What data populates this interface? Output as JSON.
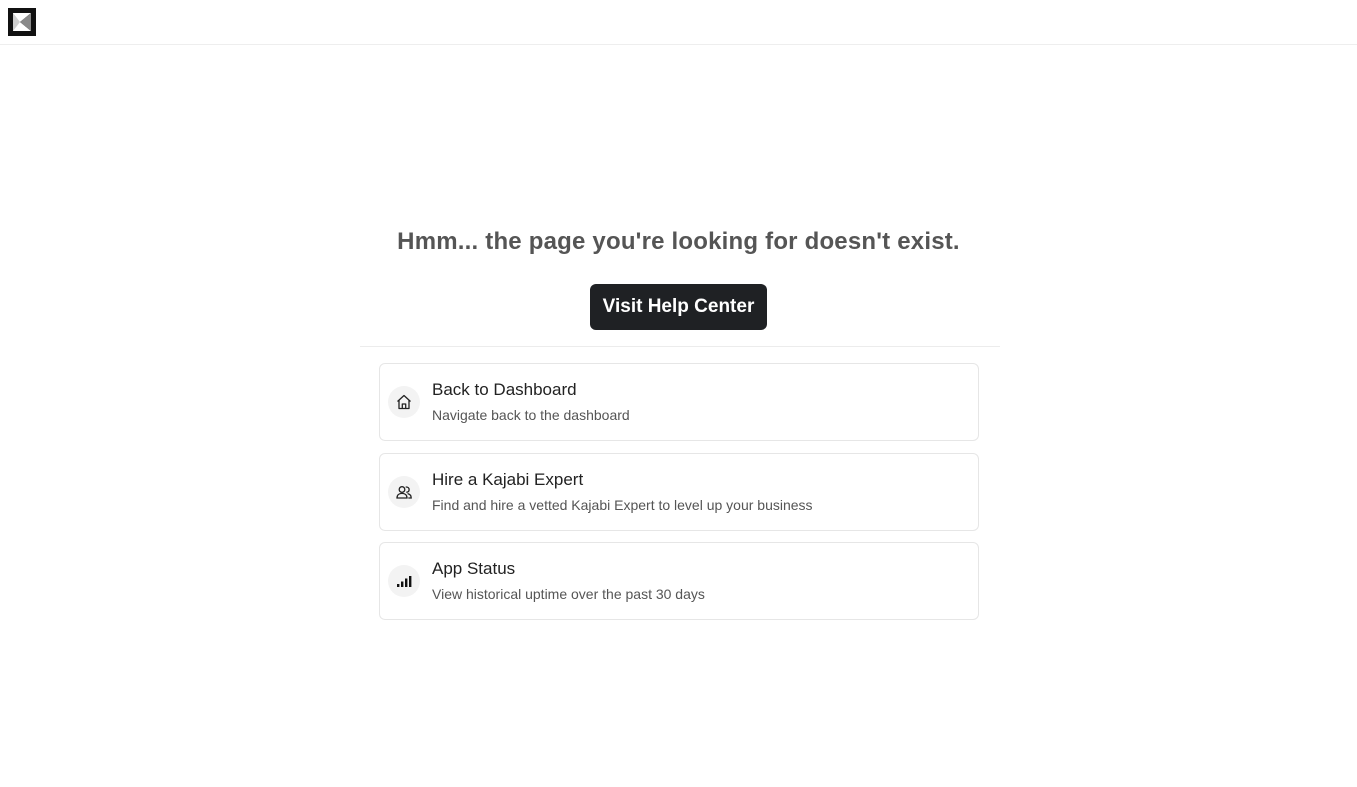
{
  "header": {
    "logo_icon": "kajabi-logo-icon"
  },
  "error": {
    "headline": "Hmm... the page you're looking for doesn't exist.",
    "help_button_label": "Visit Help Center"
  },
  "links": [
    {
      "icon": "home-icon",
      "title": "Back to Dashboard",
      "description": "Navigate back to the dashboard"
    },
    {
      "icon": "users-icon",
      "title": "Hire a Kajabi Expert",
      "description": "Find and hire a vetted Kajabi Expert to level up your business"
    },
    {
      "icon": "signal-bars-icon",
      "title": "App Status",
      "description": "View historical uptime over the past 30 days"
    }
  ],
  "colors": {
    "button_bg": "#1f2124",
    "headline": "#555555",
    "card_border": "#e6e6e6"
  }
}
